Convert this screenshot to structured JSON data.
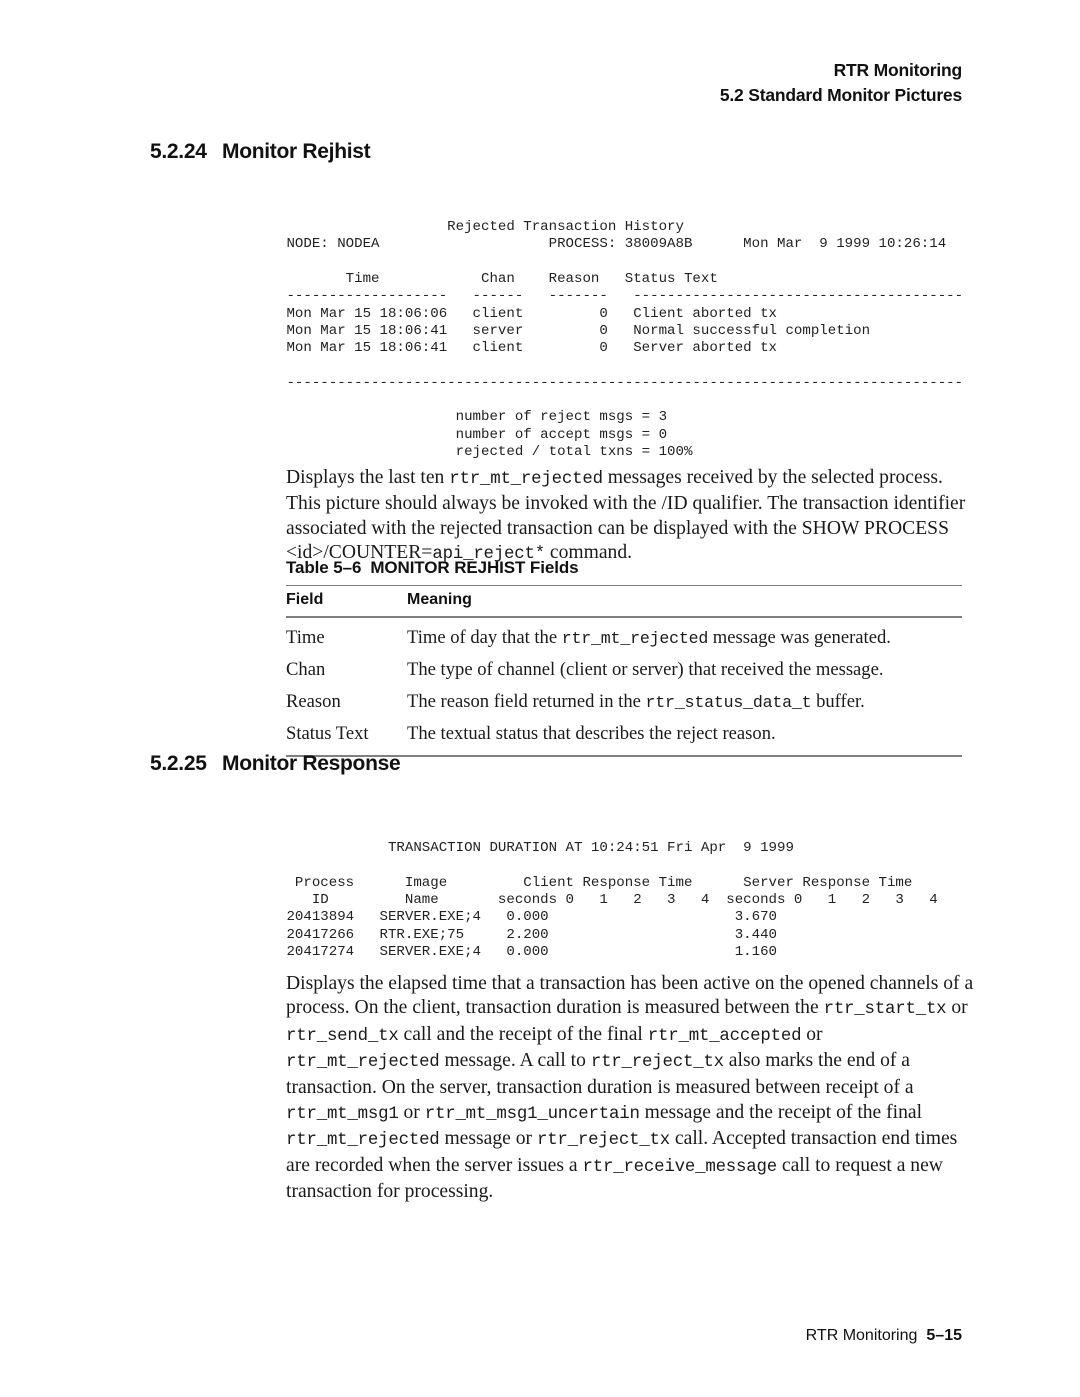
{
  "running_head": {
    "line1": "RTR Monitoring",
    "line2": "5.2 Standard Monitor Pictures"
  },
  "sections": {
    "rejhist": {
      "number": "5.2.24",
      "title": "Monitor Rejhist",
      "screen": "                    Rejected Transaction History\n NODE: NODEA                    PROCESS: 38009A8B      Mon Mar  9 1999 10:26:14\n\n        Time            Chan    Reason   Status Text\n -------------------   ------   -------   ---------------------------------------\n Mon Mar 15 18:06:06   client         0   Client aborted tx\n Mon Mar 15 18:06:41   server         0   Normal successful completion\n Mon Mar 15 18:06:41   client         0   Server aborted tx\n\n --------------------------------------------------------------------------------\n\n                     number of reject msgs = 3\n                     number of accept msgs = 0\n                     rejected / total txns = 100%",
      "paragraph": {
        "t1": "Displays the last ten ",
        "m1": "rtr_mt_rejected",
        "t2": " messages received by the selected process. This picture should always be invoked with the /ID qualifier. The transaction identifier associated with the rejected transaction can be displayed with the SHOW PROCESS <id>/COUNTER=",
        "m2": "api_reject*",
        "t3": " command."
      }
    },
    "response": {
      "number": "5.2.25",
      "title": "Monitor Response",
      "screen": "             TRANSACTION DURATION AT 10:24:51 Fri Apr  9 1999\n\n  Process      Image         Client Response Time      Server Response Time\n    ID         Name       seconds 0   1   2   3   4  seconds 0   1   2   3   4\n 20413894   SERVER.EXE;4   0.000                      3.670\n 20417266   RTR.EXE;75     2.200                      3.440\n 20417274   SERVER.EXE;4   0.000                      1.160",
      "paragraph": {
        "t1": "Displays the elapsed time that a transaction has been active on the opened channels of a process. On the client, transaction duration is measured between the ",
        "m1": "rtr_start_tx",
        "t2": " or ",
        "m2": "rtr_send_tx",
        "t3": " call and the receipt of the final ",
        "m3": "rtr_mt_accepted",
        "t4": " or ",
        "m4": "rtr_mt_rejected",
        "t5": " message. A call to ",
        "m5": "rtr_reject_tx",
        "t6": " also marks the end of a transaction. On the server, transaction duration is measured between receipt of a ",
        "m6": "rtr_mt_msg1",
        "t7": " or ",
        "m7": "rtr_mt_msg1_uncertain",
        "t8": " message and the receipt of the final ",
        "m8": "rtr_mt_rejected",
        "t9": " message or ",
        "m9": "rtr_reject_tx",
        "t10": " call. Accepted transaction end times are recorded when the server issues a ",
        "m10": "rtr_receive_message",
        "t11": " call to request a new transaction for processing."
      }
    }
  },
  "table": {
    "caption_number": "Table 5–6",
    "caption_title": "MONITOR REJHIST Fields",
    "columns": [
      "Field",
      "Meaning"
    ],
    "rows": [
      {
        "field": "Time",
        "meaning_t1": "Time of day that the ",
        "meaning_m": "rtr_mt_rejected",
        "meaning_t2": " message was generated."
      },
      {
        "field": "Chan",
        "meaning_t1": "The type of channel (client or server) that received the message.",
        "meaning_m": "",
        "meaning_t2": ""
      },
      {
        "field": "Reason",
        "meaning_t1": "The reason field returned in the ",
        "meaning_m": "rtr_status_data_t",
        "meaning_t2": " buffer."
      },
      {
        "field": "Status Text",
        "meaning_t1": "The textual status that describes the reject reason.",
        "meaning_m": "",
        "meaning_t2": ""
      }
    ]
  },
  "footer": {
    "label": "RTR Monitoring",
    "page": "5–15"
  }
}
